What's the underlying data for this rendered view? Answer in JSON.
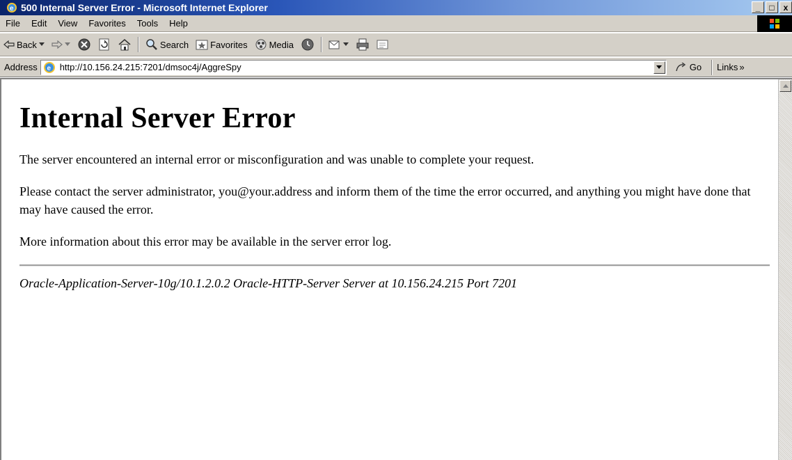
{
  "window": {
    "title": "500 Internal Server Error - Microsoft Internet Explorer",
    "minimize_label": "_",
    "maximize_label": "□",
    "close_label": "x"
  },
  "menu": {
    "items": [
      "File",
      "Edit",
      "View",
      "Favorites",
      "Tools",
      "Help"
    ]
  },
  "toolbar": {
    "back_label": "Back",
    "search_label": "Search",
    "favorites_label": "Favorites",
    "media_label": "Media"
  },
  "address_bar": {
    "label": "Address",
    "url": "http://10.156.24.215:7201/dmsoc4j/AggreSpy",
    "go_label": "Go",
    "links_label": "Links",
    "links_chevron": "»"
  },
  "page": {
    "heading": "Internal Server Error",
    "paragraph_1": "The server encountered an internal error or misconfiguration and was unable to complete your request.",
    "paragraph_2": "Please contact the server administrator, you@your.address and inform them of the time the error occurred, and anything you might have done that may have caused the error.",
    "paragraph_3": "More information about this error may be available in the server error log.",
    "server_signature": "Oracle-Application-Server-10g/10.1.2.0.2 Oracle-HTTP-Server Server at 10.156.24.215 Port 7201"
  },
  "colors": {
    "titlebar_start": "#0a246a",
    "titlebar_end": "#a6caf0",
    "chrome_gray": "#d4d0c8"
  },
  "icons": [
    "ie-logo-icon",
    "windows-flag-icon",
    "back-arrow-icon",
    "forward-arrow-icon",
    "stop-icon",
    "refresh-icon",
    "home-icon",
    "search-icon",
    "favorites-icon",
    "media-icon",
    "history-icon",
    "mail-icon",
    "print-icon",
    "edit-icon",
    "dropdown-arrow-icon",
    "go-arrow-icon",
    "scroll-up-arrow-icon"
  ]
}
